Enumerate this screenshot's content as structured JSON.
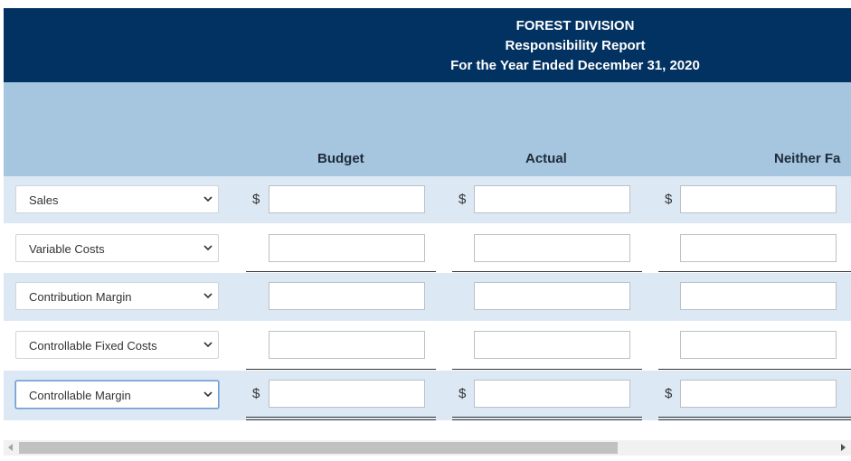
{
  "report": {
    "division": "FOREST DIVISION",
    "title": "Responsibility Report",
    "period": "For the Year Ended December 31, 2020"
  },
  "columns": {
    "budget": "Budget",
    "actual": "Actual",
    "difference": "Neither Fa"
  },
  "currency_symbol": "$",
  "rows": [
    {
      "label": "Sales",
      "budget": "",
      "actual": "",
      "difference": ""
    },
    {
      "label": "Variable Costs",
      "budget": "",
      "actual": "",
      "difference": ""
    },
    {
      "label": "Contribution Margin",
      "budget": "",
      "actual": "",
      "difference": ""
    },
    {
      "label": "Controllable Fixed Costs",
      "budget": "",
      "actual": "",
      "difference": ""
    },
    {
      "label": "Controllable Margin",
      "budget": "",
      "actual": "",
      "difference": ""
    }
  ],
  "icons": {
    "dropdown": "chevron-down-icon",
    "scroll_left": "scroll-left-arrow-icon",
    "scroll_right": "scroll-right-arrow-icon"
  },
  "colors": {
    "header_bg": "#023261",
    "subheader_bg": "#a6c5df",
    "row_shade": "#dce8f4"
  }
}
